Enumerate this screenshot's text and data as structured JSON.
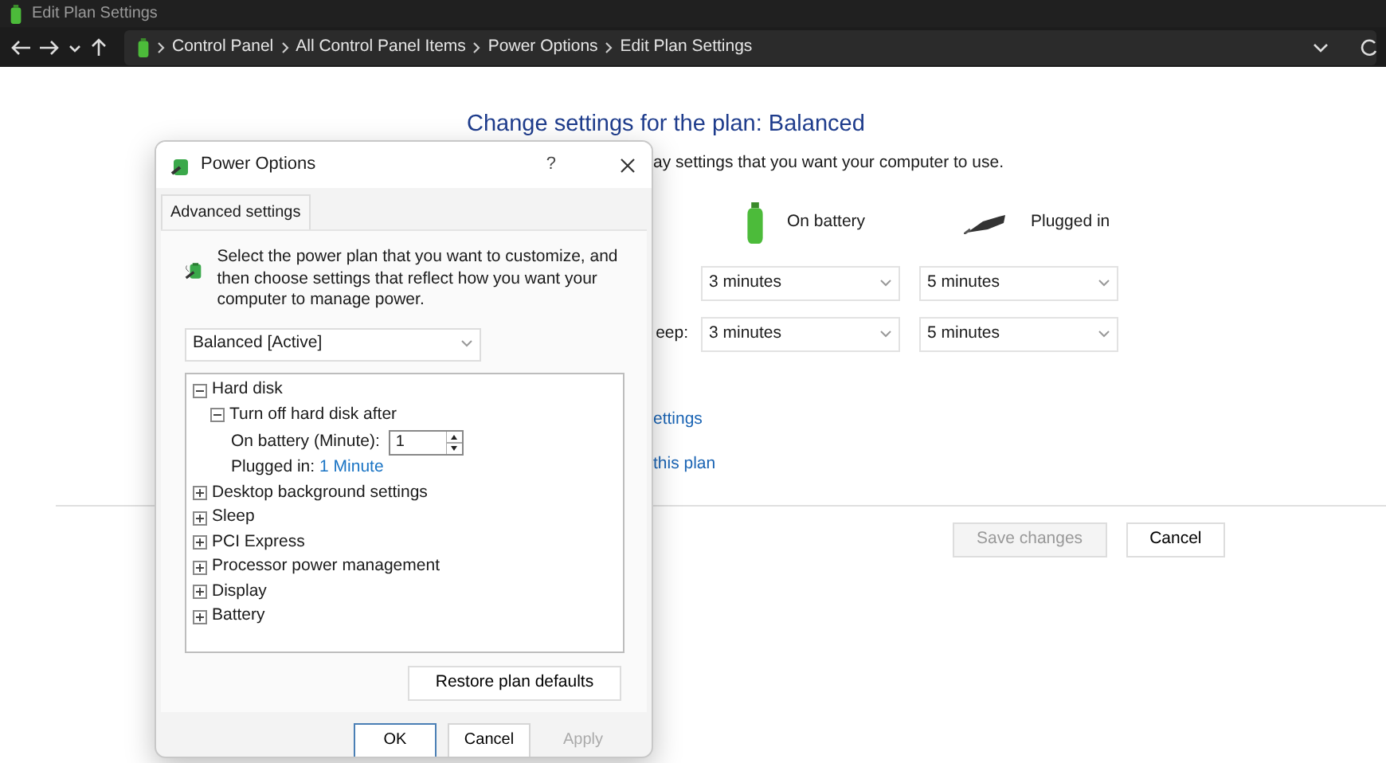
{
  "window": {
    "title": "Edit Plan Settings"
  },
  "address_bar": {
    "breadcrumbs": [
      "Control Panel",
      "All Control Panel Items",
      "Power Options",
      "Edit Plan Settings"
    ]
  },
  "page": {
    "heading": "Change settings for the plan: Balanced",
    "subtitle": "ay settings that you want your computer to use.",
    "columns": [
      "On battery",
      "Plugged in"
    ],
    "settings": [
      {
        "values": [
          "3 minutes",
          "5 minutes"
        ]
      },
      {
        "label": "eep:",
        "values": [
          "3 minutes",
          "5 minutes"
        ]
      }
    ],
    "links": [
      "ettings",
      "this plan"
    ],
    "buttons": [
      {
        "label": "Save changes",
        "disabled": true
      },
      {
        "label": "Cancel",
        "disabled": false
      }
    ]
  },
  "dialog": {
    "title": "Power Options",
    "help": "?",
    "tab": "Advanced settings",
    "description": "Select the power plan that you want to customize, and then choose settings that reflect how you want your computer to manage power.",
    "plan": "Balanced [Active]",
    "tree": [
      {
        "label": "Hard disk",
        "expanded": true,
        "children": [
          {
            "label": "Turn off hard disk after",
            "expanded": true,
            "children": [
              {
                "kind": "spin",
                "label": "On battery (Minute):",
                "value": "1"
              },
              {
                "kind": "link",
                "label": "Plugged in:",
                "value": "1 Minute"
              }
            ]
          }
        ]
      },
      {
        "label": "Desktop background settings",
        "expanded": false
      },
      {
        "label": "Sleep",
        "expanded": false
      },
      {
        "label": "PCI Express",
        "expanded": false
      },
      {
        "label": "Processor power management",
        "expanded": false
      },
      {
        "label": "Display",
        "expanded": false
      },
      {
        "label": "Battery",
        "expanded": false
      }
    ],
    "restore_button": "Restore plan defaults",
    "buttons": [
      {
        "label": "OK",
        "default": true,
        "disabled": false
      },
      {
        "label": "Cancel",
        "default": false,
        "disabled": false
      },
      {
        "label": "Apply",
        "default": false,
        "disabled": true
      }
    ]
  }
}
